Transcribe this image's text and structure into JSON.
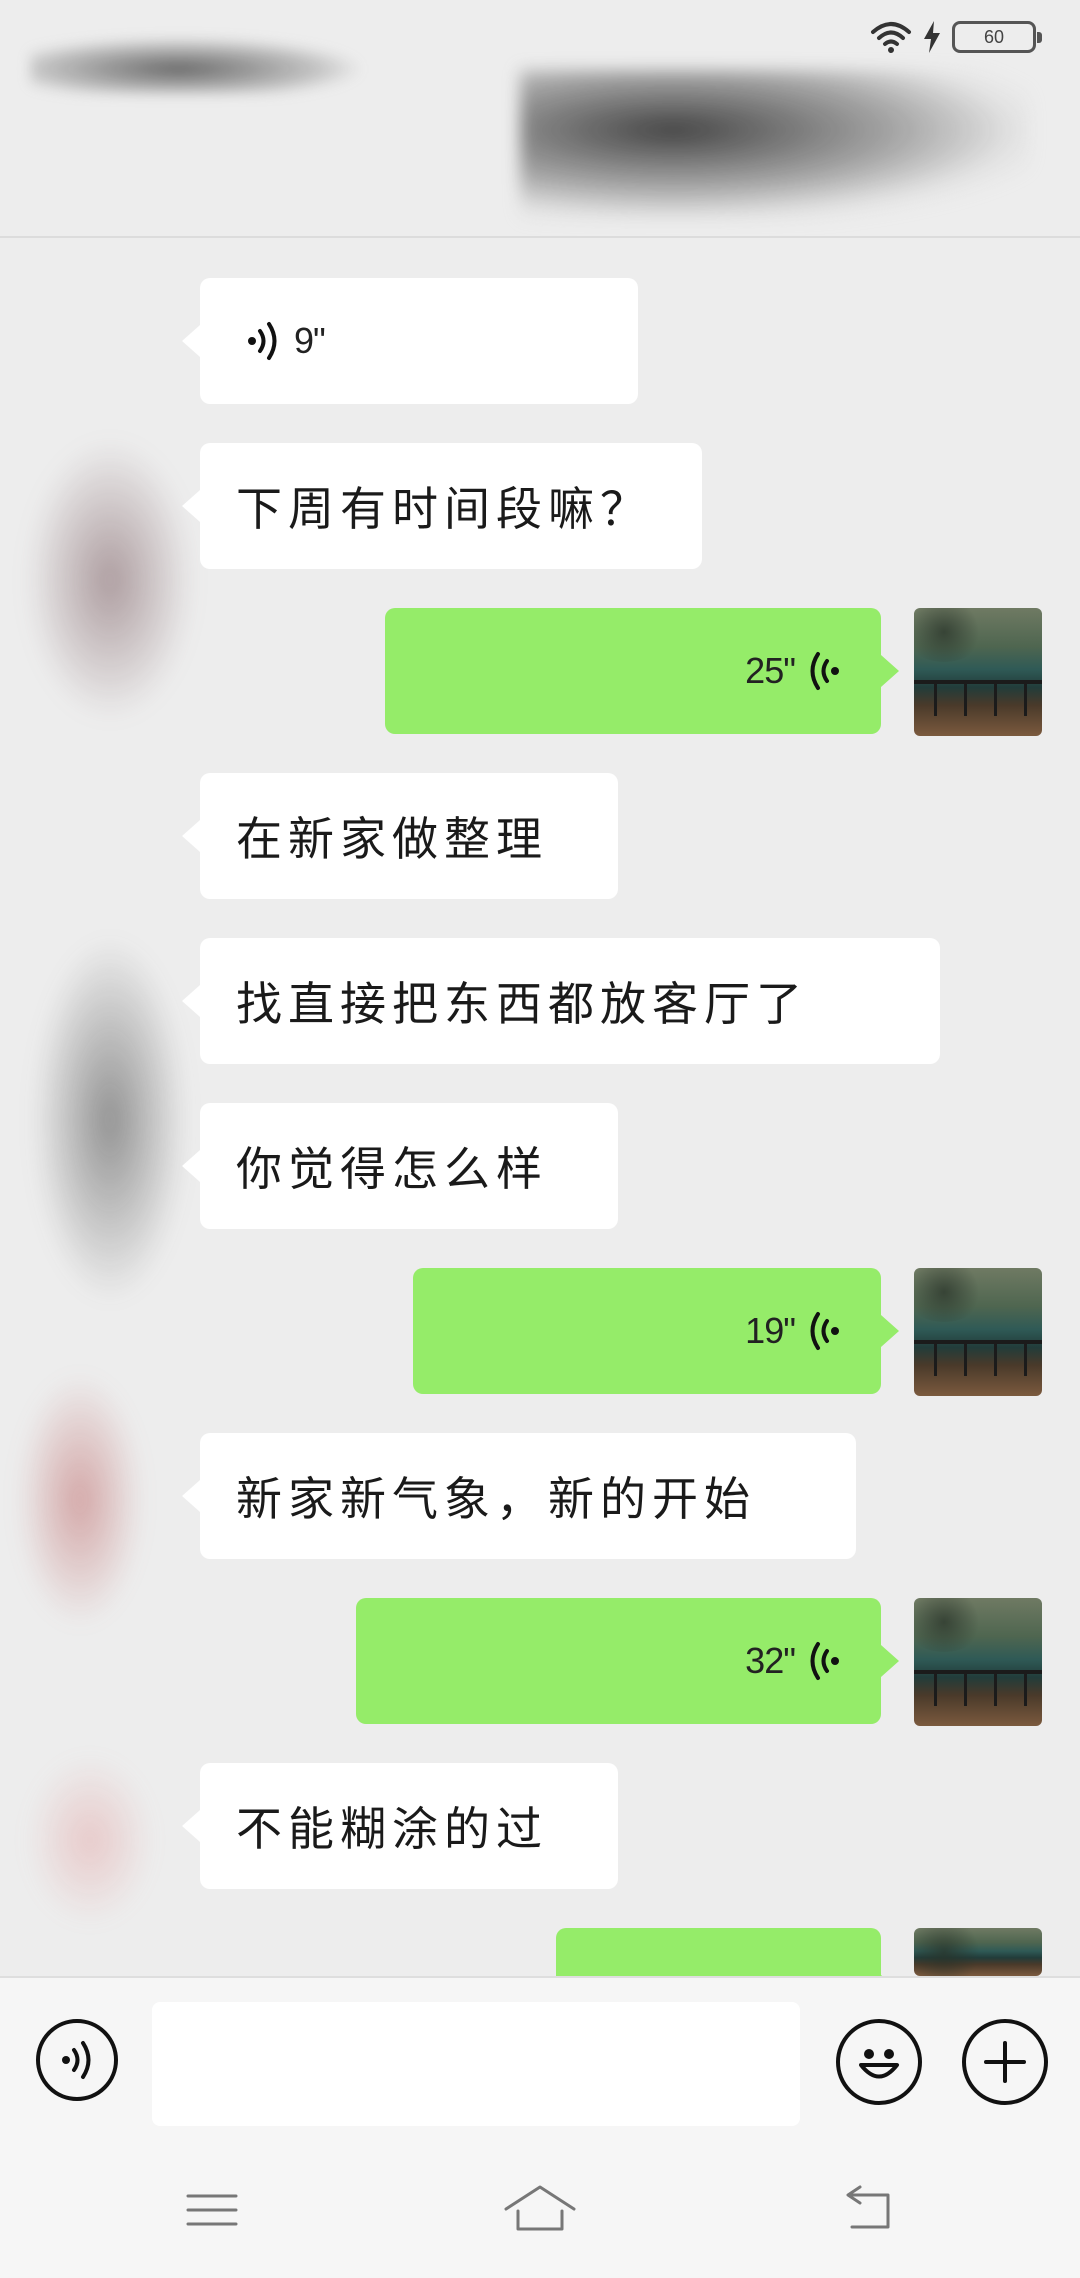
{
  "status_bar": {
    "time": "",
    "battery_level": "60",
    "icons": [
      "wifi-icon",
      "charging-icon",
      "battery-icon"
    ]
  },
  "header": {
    "contact_name": "",
    "redacted": true
  },
  "colors": {
    "background": "#ededed",
    "incoming_bubble": "#ffffff",
    "outgoing_bubble": "#95ec69",
    "input_bar": "#f6f6f6"
  },
  "messages": [
    {
      "direction": "incoming",
      "type": "voice",
      "duration": "9\""
    },
    {
      "direction": "incoming",
      "type": "text",
      "text": "下周有时间段嘛？"
    },
    {
      "direction": "outgoing",
      "type": "voice",
      "duration": "25\""
    },
    {
      "direction": "incoming",
      "type": "text",
      "text": "在新家做整理"
    },
    {
      "direction": "incoming",
      "type": "text",
      "text": "找直接把东西都放客厅了"
    },
    {
      "direction": "incoming",
      "type": "text",
      "text": "你觉得怎么样"
    },
    {
      "direction": "outgoing",
      "type": "voice",
      "duration": "19\""
    },
    {
      "direction": "incoming",
      "type": "text",
      "text": "新家新气象，新的开始"
    },
    {
      "direction": "outgoing",
      "type": "voice",
      "duration": "32\""
    },
    {
      "direction": "incoming",
      "type": "text",
      "text": "不能糊涂的过"
    },
    {
      "direction": "outgoing",
      "type": "voice",
      "duration": ""
    }
  ],
  "input_bar": {
    "voice_button_icon": "voice-icon",
    "message_value": "",
    "emoji_button_icon": "emoji-icon",
    "more_button_icon": "plus-icon"
  },
  "nav_bar": {
    "buttons": [
      "menu-icon",
      "home-icon",
      "back-icon"
    ]
  }
}
